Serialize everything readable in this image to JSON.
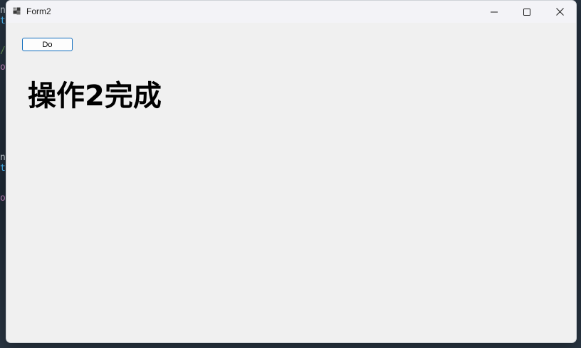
{
  "window": {
    "title": "Form2",
    "icon": "app-window-icon",
    "controls": {
      "minimize_icon": "minimize-icon",
      "maximize_icon": "maximize-icon",
      "close_icon": "close-icon"
    }
  },
  "form": {
    "do_button_label": "Do",
    "status_text": "操作2完成"
  },
  "colors": {
    "button_border": "#0f6cbd",
    "client_background": "#f0f0f0",
    "titlebar_background": "#f3f3f7"
  }
}
